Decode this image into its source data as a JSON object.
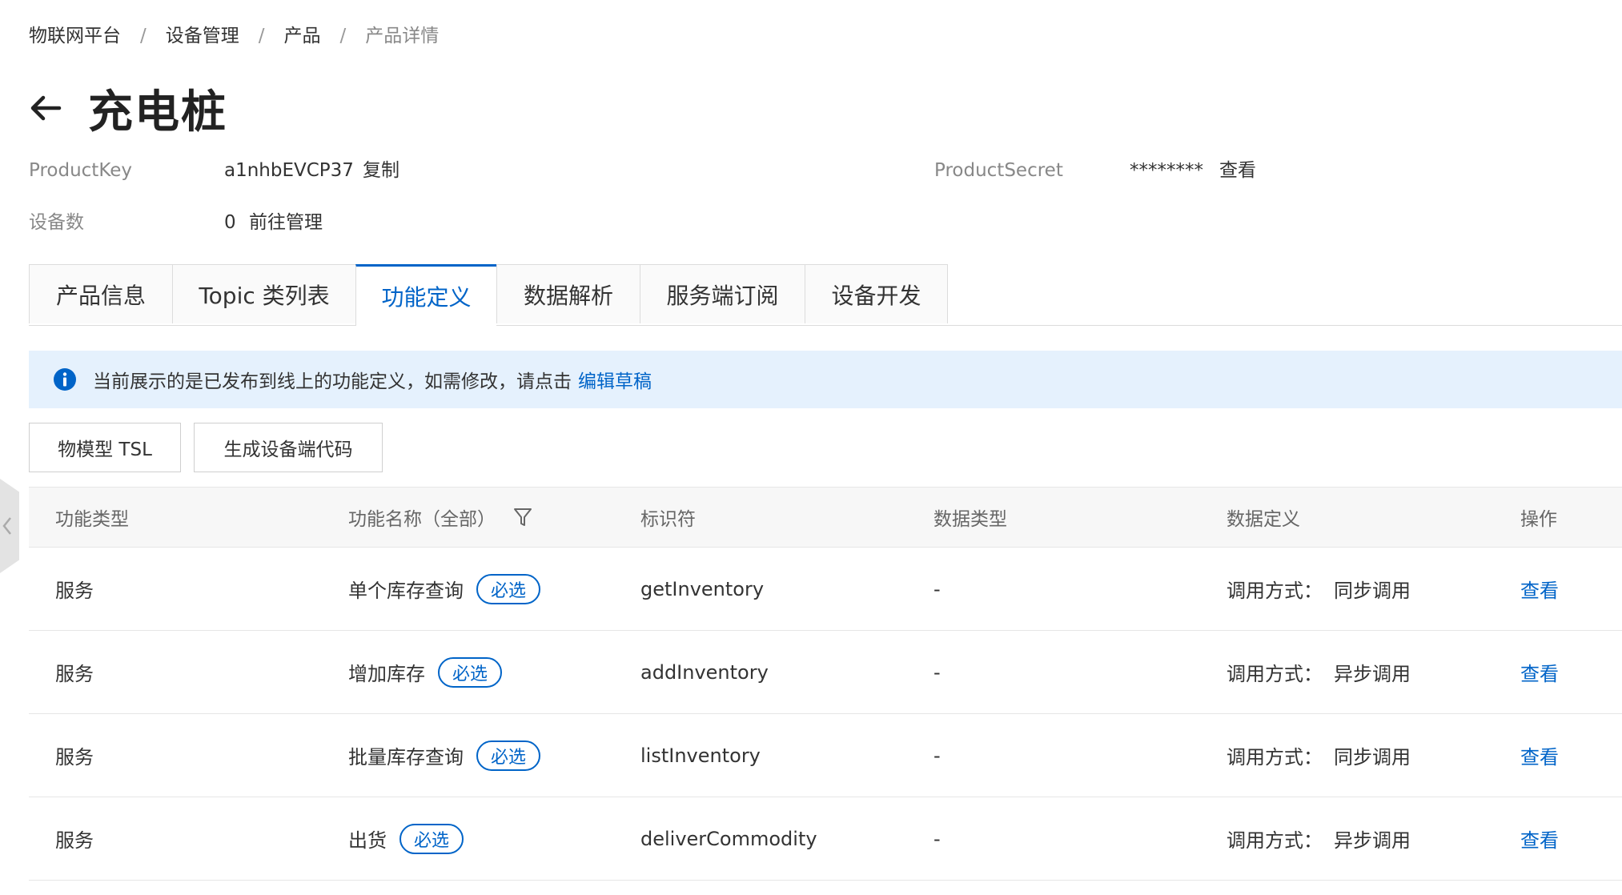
{
  "breadcrumb": {
    "items": [
      "物联网平台",
      "设备管理",
      "产品",
      "产品详情"
    ],
    "separator": "/"
  },
  "header": {
    "title": "充电桩",
    "back_icon": "arrow-left-icon"
  },
  "meta": {
    "product_key_label": "ProductKey",
    "product_key_value": "a1nhbEVCP37",
    "copy_link": "复制",
    "product_secret_label": "ProductSecret",
    "product_secret_value": "********",
    "view_link": "查看",
    "device_count_label": "设备数",
    "device_count_value": "0",
    "manage_link": "前往管理"
  },
  "tabs": [
    {
      "label": "产品信息",
      "active": false
    },
    {
      "label": "Topic 类列表",
      "active": false
    },
    {
      "label": "功能定义",
      "active": true
    },
    {
      "label": "数据解析",
      "active": false
    },
    {
      "label": "服务端订阅",
      "active": false
    },
    {
      "label": "设备开发",
      "active": false
    }
  ],
  "alert": {
    "icon": "info-icon",
    "text": "当前展示的是已发布到线上的功能定义，如需修改，请点击",
    "link": "编辑草稿"
  },
  "toolbar": {
    "tsl_button": "物模型 TSL",
    "gen_code_button": "生成设备端代码"
  },
  "table": {
    "headers": [
      "功能类型",
      "功能名称（全部）",
      "标识符",
      "数据类型",
      "数据定义",
      "操作"
    ],
    "rows": [
      {
        "type": "服务",
        "name": "单个库存查询",
        "tag": "必选",
        "identifier": "getInventory",
        "data_type": "-",
        "def_label": "调用方式：",
        "def_value": "同步调用",
        "action": "查看"
      },
      {
        "type": "服务",
        "name": "增加库存",
        "tag": "必选",
        "identifier": "addInventory",
        "data_type": "-",
        "def_label": "调用方式：",
        "def_value": "异步调用",
        "action": "查看"
      },
      {
        "type": "服务",
        "name": "批量库存查询",
        "tag": "必选",
        "identifier": "listInventory",
        "data_type": "-",
        "def_label": "调用方式：",
        "def_value": "同步调用",
        "action": "查看"
      },
      {
        "type": "服务",
        "name": "出货",
        "tag": "必选",
        "identifier": "deliverCommodity",
        "data_type": "-",
        "def_label": "调用方式：",
        "def_value": "异步调用",
        "action": "查看"
      }
    ]
  },
  "colors": {
    "accent": "#0064c8",
    "alert_bg": "#e5f1fd",
    "header_bg": "#f7f7f7"
  }
}
